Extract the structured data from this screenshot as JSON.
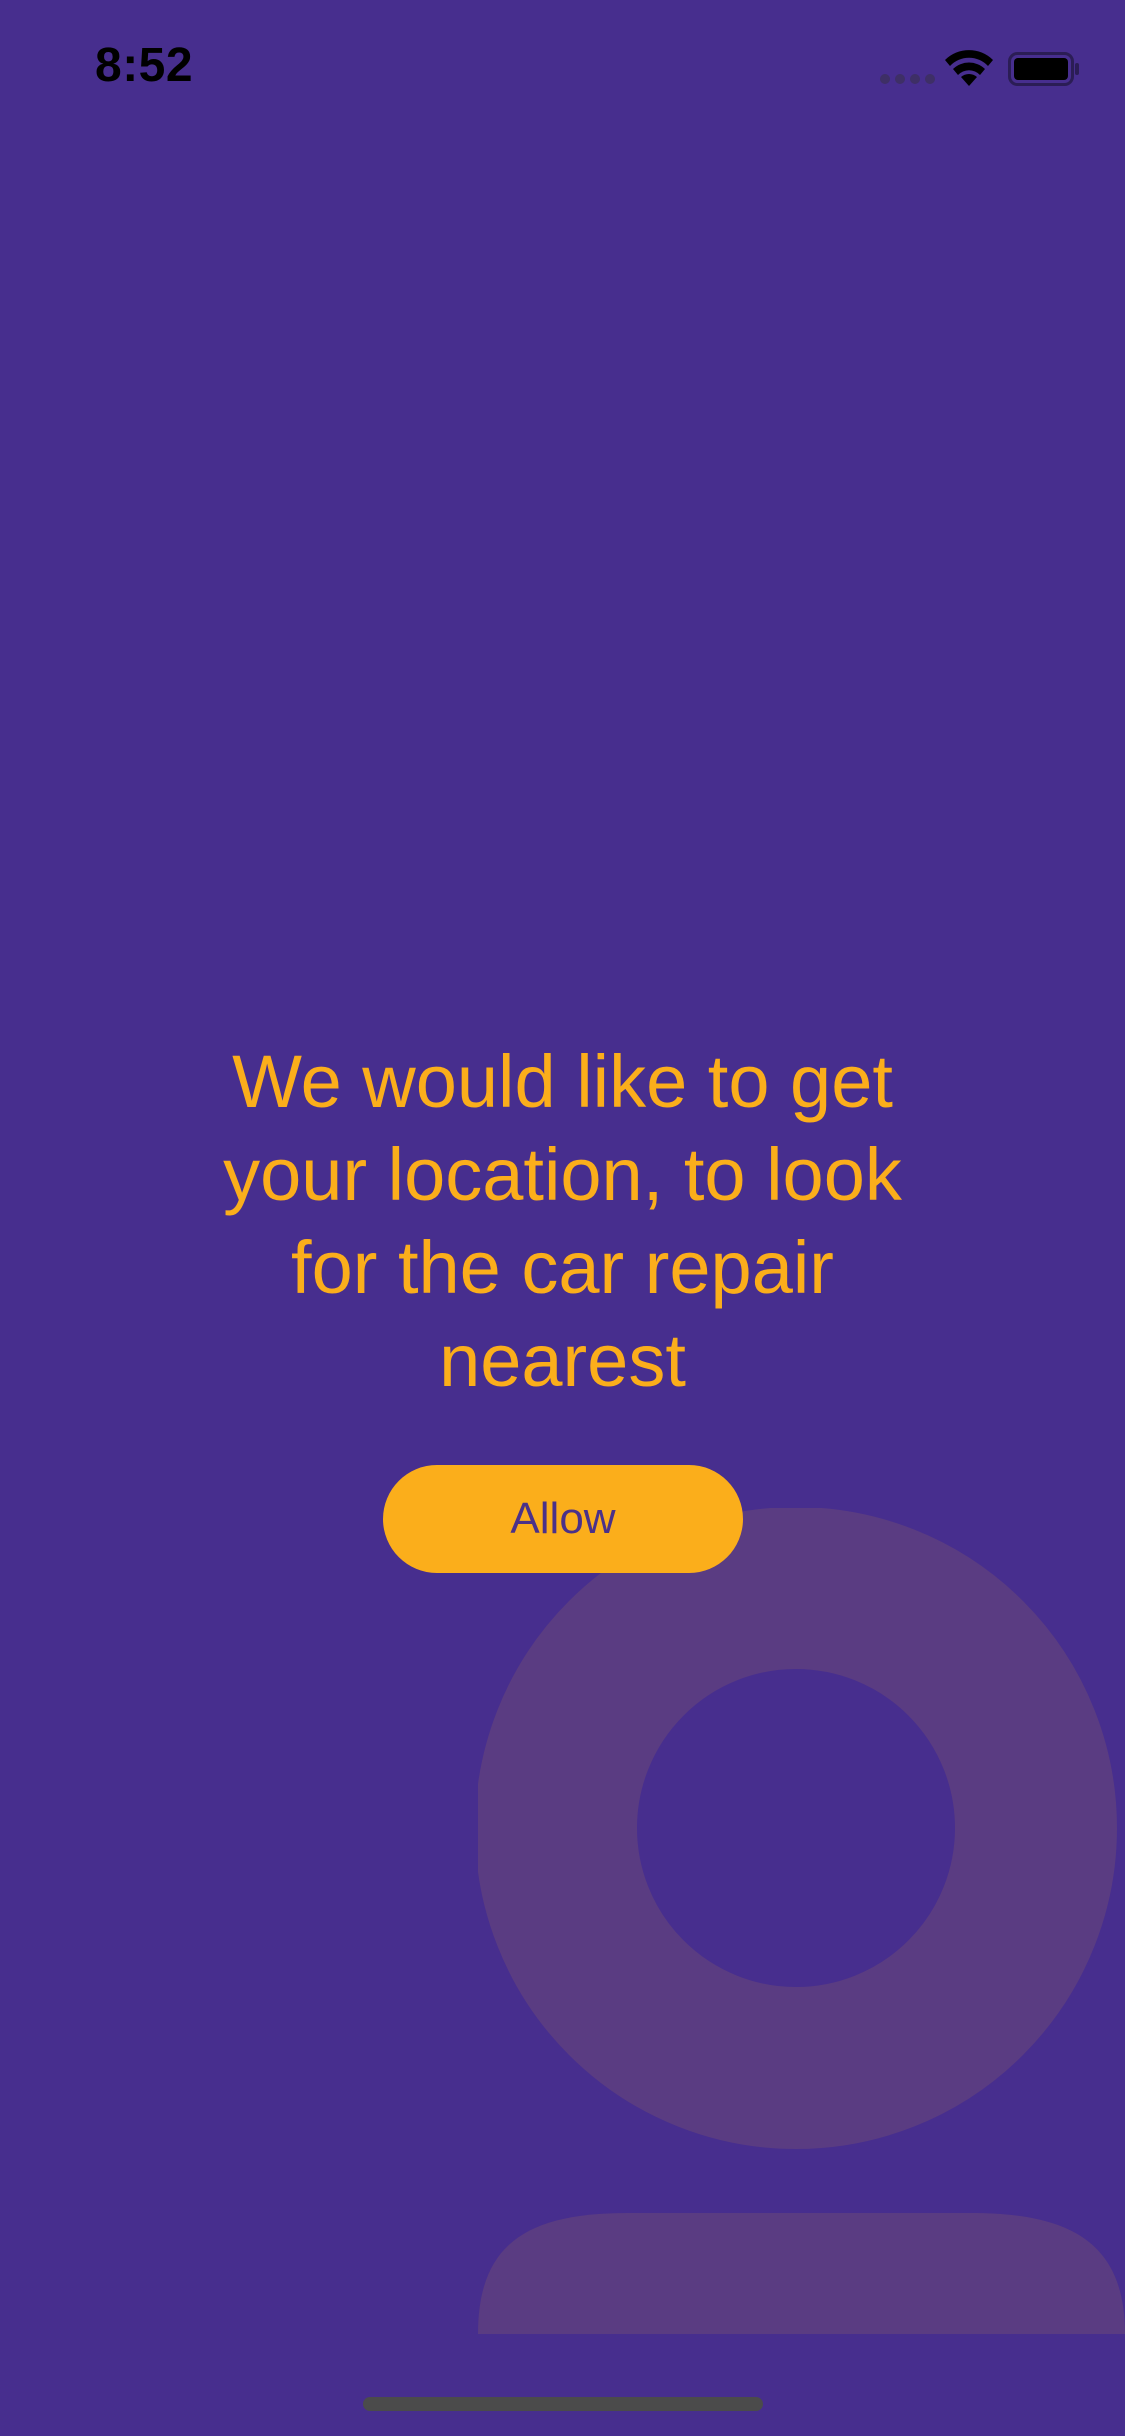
{
  "status_bar": {
    "time": "8:52",
    "icons": [
      "signal-dots-icon",
      "wifi-icon",
      "battery-icon"
    ]
  },
  "prompt": {
    "message": "We would like to get your location, to look for the car repair nearest"
  },
  "actions": {
    "allow_label": "Allow"
  },
  "decoration": {
    "icon": "person-icon"
  },
  "colors": {
    "background": "#472E8E",
    "accent": "#FBAE1B",
    "button_text": "#4B3189",
    "decoration": "#5A3C82"
  }
}
